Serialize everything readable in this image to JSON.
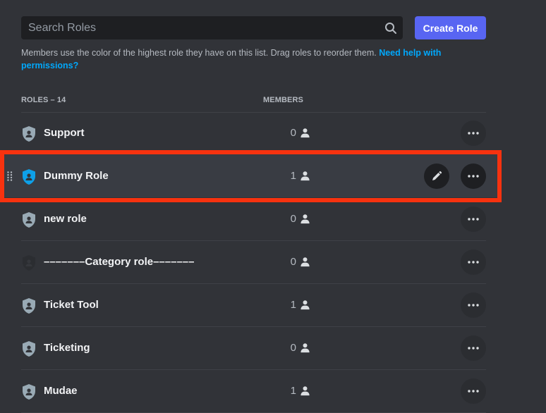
{
  "search": {
    "placeholder": "Search Roles",
    "icon": "search-icon"
  },
  "create_button": {
    "label": "Create Role"
  },
  "hint": {
    "text": "Members use the color of the highest role they have on this list. Drag roles to reorder them. ",
    "link": "Need help with permissions?"
  },
  "columns": {
    "roles": "ROLES – 14",
    "members": "MEMBERS"
  },
  "colors": {
    "accent": "#5865f2",
    "link": "#00a8fc",
    "highlight": "#f7320f",
    "default_role": "#99aab5",
    "dummy_role": "#0ea0e8",
    "category_role": "#2b2d31"
  },
  "roles": [
    {
      "name": "Support",
      "members": "0",
      "color": "#99aab5"
    },
    {
      "name": "Dummy Role",
      "members": "1",
      "color": "#0ea0e8",
      "selected": true
    },
    {
      "name": "new role",
      "members": "0",
      "color": "#99aab5"
    },
    {
      "name": "–––––––Category role–––––––",
      "members": "0",
      "color": "#2b2d31"
    },
    {
      "name": "Ticket Tool",
      "members": "1",
      "color": "#99aab5"
    },
    {
      "name": "Ticketing",
      "members": "0",
      "color": "#99aab5"
    },
    {
      "name": "Mudae",
      "members": "1",
      "color": "#99aab5"
    }
  ]
}
